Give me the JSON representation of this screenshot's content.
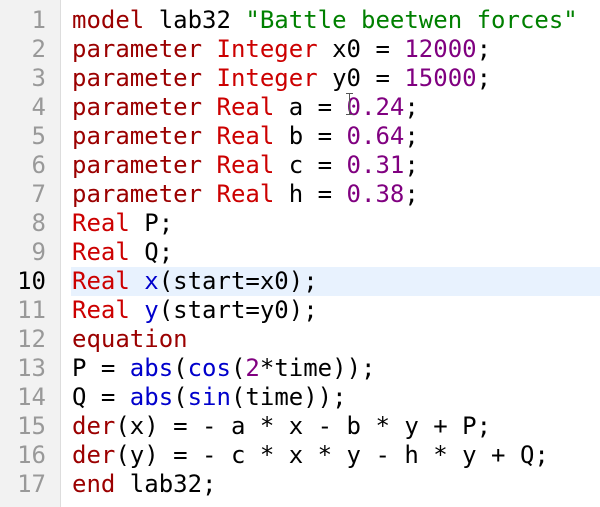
{
  "editor": {
    "current_line": 10,
    "lines": [
      {
        "num": "1",
        "tokens": [
          {
            "t": "model",
            "k": "keyword"
          },
          {
            "t": " lab32 ",
            "k": "plain"
          },
          {
            "t": "\"Battle beetwen forces\"",
            "k": "string"
          }
        ]
      },
      {
        "num": "2",
        "tokens": [
          {
            "t": "parameter",
            "k": "keyword"
          },
          {
            "t": " ",
            "k": "plain"
          },
          {
            "t": "Integer",
            "k": "type"
          },
          {
            "t": " x0 = ",
            "k": "plain"
          },
          {
            "t": "12000",
            "k": "number"
          },
          {
            "t": ";",
            "k": "plain"
          }
        ]
      },
      {
        "num": "3",
        "tokens": [
          {
            "t": "parameter",
            "k": "keyword"
          },
          {
            "t": " ",
            "k": "plain"
          },
          {
            "t": "Integer",
            "k": "type"
          },
          {
            "t": " y0 = ",
            "k": "plain"
          },
          {
            "t": "15000",
            "k": "number"
          },
          {
            "t": ";",
            "k": "plain"
          }
        ]
      },
      {
        "num": "4",
        "tokens": [
          {
            "t": "parameter",
            "k": "keyword"
          },
          {
            "t": " ",
            "k": "plain"
          },
          {
            "t": "Real",
            "k": "type"
          },
          {
            "t": " a = ",
            "k": "plain"
          },
          {
            "t": "0.24",
            "k": "number"
          },
          {
            "t": ";",
            "k": "plain"
          }
        ]
      },
      {
        "num": "5",
        "tokens": [
          {
            "t": "parameter",
            "k": "keyword"
          },
          {
            "t": " ",
            "k": "plain"
          },
          {
            "t": "Real",
            "k": "type"
          },
          {
            "t": " b = ",
            "k": "plain"
          },
          {
            "t": "0.64",
            "k": "number"
          },
          {
            "t": ";",
            "k": "plain"
          }
        ]
      },
      {
        "num": "6",
        "tokens": [
          {
            "t": "parameter",
            "k": "keyword"
          },
          {
            "t": " ",
            "k": "plain"
          },
          {
            "t": "Real",
            "k": "type"
          },
          {
            "t": " c = ",
            "k": "plain"
          },
          {
            "t": "0.31",
            "k": "number"
          },
          {
            "t": ";",
            "k": "plain"
          }
        ]
      },
      {
        "num": "7",
        "tokens": [
          {
            "t": "parameter",
            "k": "keyword"
          },
          {
            "t": " ",
            "k": "plain"
          },
          {
            "t": "Real",
            "k": "type"
          },
          {
            "t": " h = ",
            "k": "plain"
          },
          {
            "t": "0.38",
            "k": "number"
          },
          {
            "t": ";",
            "k": "plain"
          }
        ]
      },
      {
        "num": "8",
        "tokens": [
          {
            "t": "Real",
            "k": "type"
          },
          {
            "t": " P;",
            "k": "plain"
          }
        ]
      },
      {
        "num": "9",
        "tokens": [
          {
            "t": "Real",
            "k": "type"
          },
          {
            "t": " Q;",
            "k": "plain"
          }
        ]
      },
      {
        "num": "10",
        "tokens": [
          {
            "t": "Real",
            "k": "type"
          },
          {
            "t": " ",
            "k": "plain"
          },
          {
            "t": "x",
            "k": "var"
          },
          {
            "t": "(start=x0);",
            "k": "plain"
          }
        ]
      },
      {
        "num": "11",
        "tokens": [
          {
            "t": "Real",
            "k": "type"
          },
          {
            "t": " ",
            "k": "plain"
          },
          {
            "t": "y",
            "k": "var"
          },
          {
            "t": "(start=y0);",
            "k": "plain"
          }
        ]
      },
      {
        "num": "12",
        "tokens": [
          {
            "t": "equation",
            "k": "keyword"
          }
        ]
      },
      {
        "num": "13",
        "tokens": [
          {
            "t": "P = ",
            "k": "plain"
          },
          {
            "t": "abs",
            "k": "func"
          },
          {
            "t": "(",
            "k": "plain"
          },
          {
            "t": "cos",
            "k": "func"
          },
          {
            "t": "(",
            "k": "plain"
          },
          {
            "t": "2",
            "k": "number"
          },
          {
            "t": "*time));",
            "k": "plain"
          }
        ]
      },
      {
        "num": "14",
        "tokens": [
          {
            "t": "Q = ",
            "k": "plain"
          },
          {
            "t": "abs",
            "k": "func"
          },
          {
            "t": "(",
            "k": "plain"
          },
          {
            "t": "sin",
            "k": "func"
          },
          {
            "t": "(time));",
            "k": "plain"
          }
        ]
      },
      {
        "num": "15",
        "tokens": [
          {
            "t": "der",
            "k": "keyword"
          },
          {
            "t": "(x) = - a * x - b * y + P;",
            "k": "plain"
          }
        ]
      },
      {
        "num": "16",
        "tokens": [
          {
            "t": "der",
            "k": "keyword"
          },
          {
            "t": "(y) = - c * x * y - h * y + Q;",
            "k": "plain"
          }
        ]
      },
      {
        "num": "17",
        "tokens": [
          {
            "t": "end",
            "k": "keyword"
          },
          {
            "t": " lab32;",
            "k": "plain"
          }
        ]
      }
    ]
  }
}
